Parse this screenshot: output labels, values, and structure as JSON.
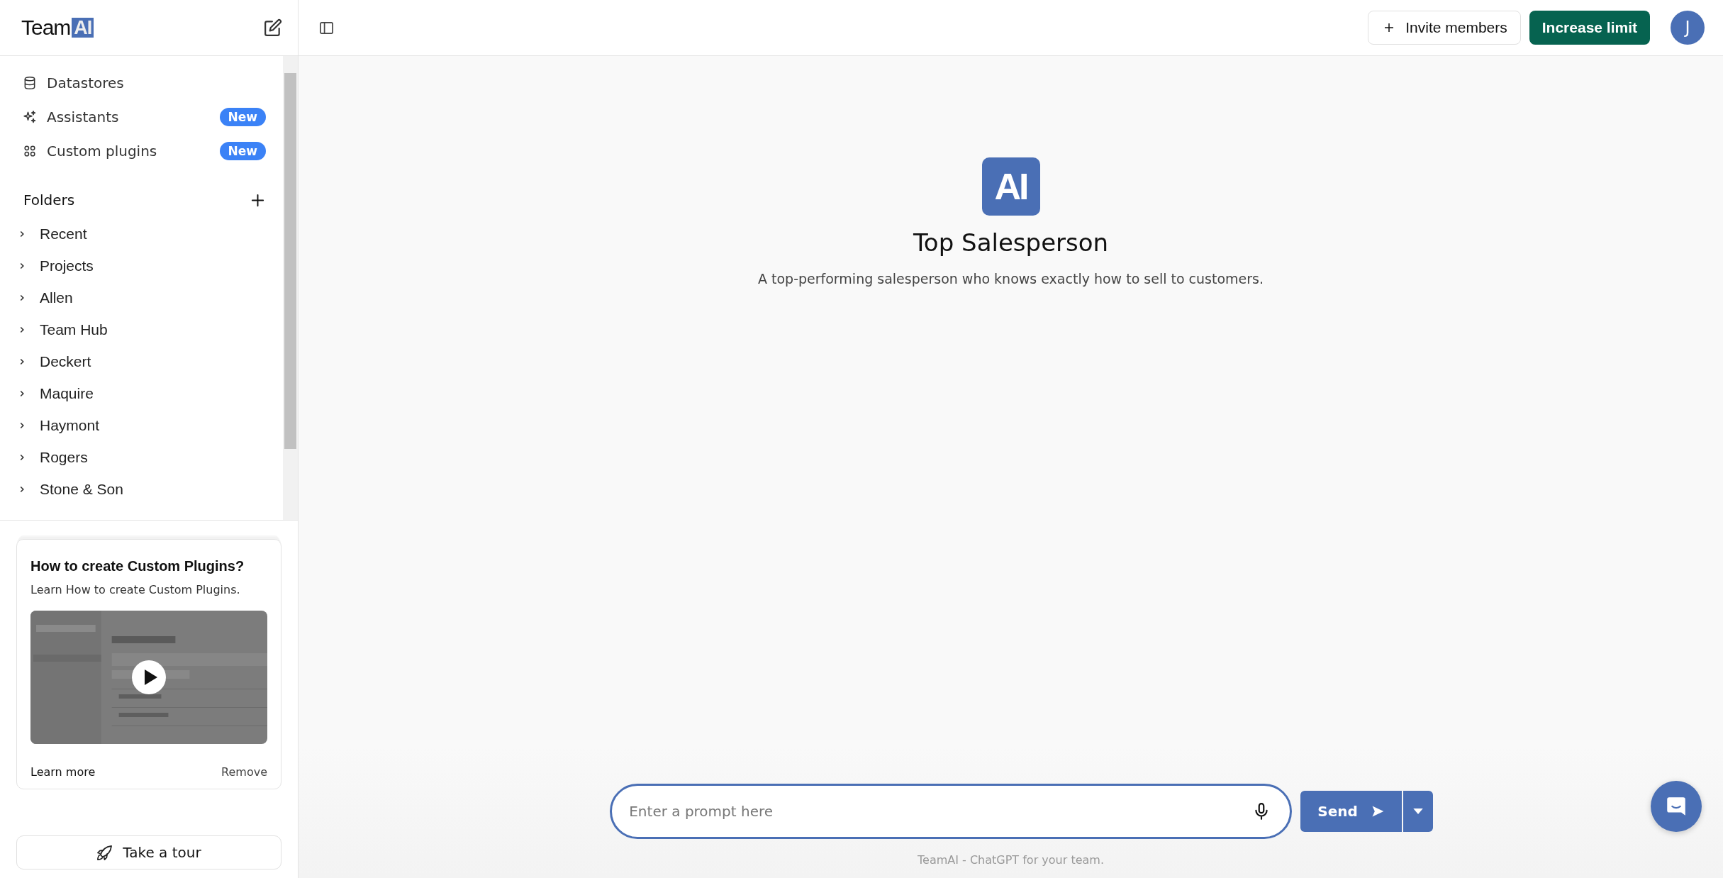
{
  "logo": {
    "text": "Team",
    "badge": "AI"
  },
  "nav_items": [
    {
      "label": "Datastores",
      "kind": "datastore"
    },
    {
      "label": "Assistants",
      "kind": "sparkle",
      "badge": "New"
    },
    {
      "label": "Custom plugins",
      "kind": "grid",
      "badge": "New"
    }
  ],
  "folders": {
    "title": "Folders",
    "items": [
      {
        "label": "Recent",
        "expanded": false
      },
      {
        "label": "Projects",
        "expanded": false
      },
      {
        "label": "Allen",
        "expanded": false
      },
      {
        "label": "Team Hub",
        "expanded": false
      },
      {
        "label": "Deckert",
        "expanded": false
      },
      {
        "label": "Maquire",
        "expanded": false
      },
      {
        "label": "Haymont",
        "expanded": false
      },
      {
        "label": "Rogers",
        "expanded": false
      },
      {
        "label": "Stone & Son",
        "expanded": false
      }
    ]
  },
  "tip_card": {
    "title": "How to create Custom Plugins?",
    "text": "Learn How to create Custom Plugins.",
    "link": "Learn more",
    "dismiss": "Remove"
  },
  "tour_button": "Take a tour",
  "header": {
    "invite": "Invite members",
    "upgrade": "Increase limit",
    "avatar": "J"
  },
  "assistant": {
    "icon": "AI",
    "name": "Top Salesperson",
    "description": "A top-performing salesperson who knows exactly how to sell to customers."
  },
  "prompt": {
    "placeholder": "Enter a prompt here",
    "send": "Send"
  },
  "footer": "TeamAI - ChatGPT for your team."
}
